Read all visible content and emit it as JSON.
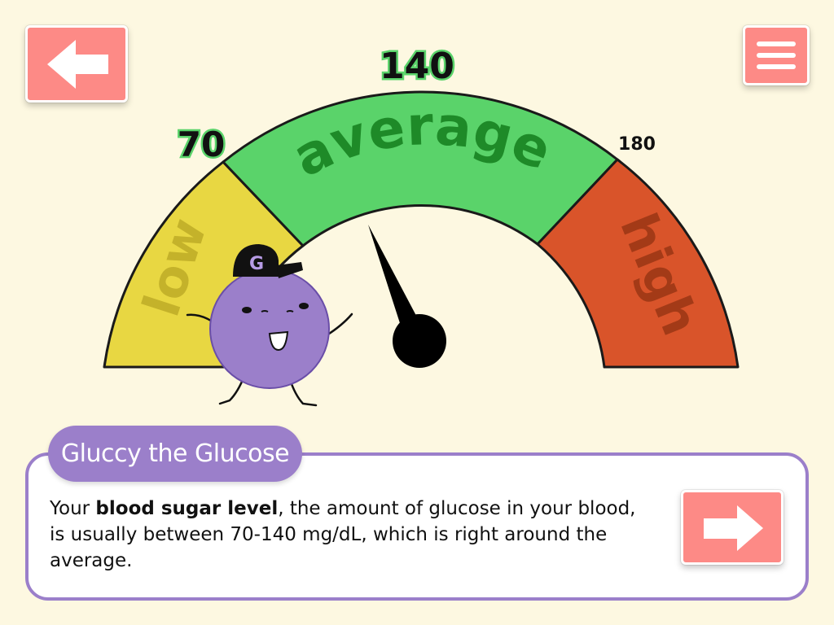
{
  "gauge": {
    "zones": [
      {
        "label": "low",
        "color": "#e8d742",
        "text_color": "#c4b22a"
      },
      {
        "label": "average",
        "color": "#5ad36a",
        "text_color": "#1e8a28"
      },
      {
        "label": "high",
        "color": "#d9542a",
        "text_color": "#a33a17"
      }
    ],
    "ticks": {
      "low": "70",
      "mid": "140",
      "high": "180"
    }
  },
  "character": {
    "cap_letter": "G",
    "body_color": "#9b7fca"
  },
  "dialog": {
    "speaker": "Gluccy the Glucose",
    "text_before": "Your ",
    "text_bold": "blood sugar level",
    "text_after": ", the amount of glucose in your blood, is usually between 70-140 mg/dL, which is right around the average."
  },
  "nav": {
    "back_icon": "arrow-left-icon",
    "menu_icon": "hamburger-menu-icon",
    "next_icon": "arrow-right-icon"
  },
  "colors": {
    "background": "#fdf8e1",
    "button": "#fd8a86",
    "accent": "#9b7fca"
  }
}
